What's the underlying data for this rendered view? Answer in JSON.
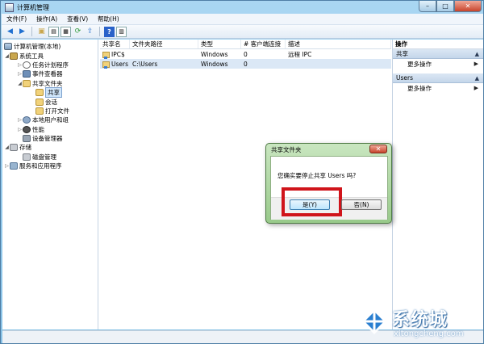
{
  "window": {
    "title": "计算机管理"
  },
  "menubar": [
    {
      "label": "文件(F)"
    },
    {
      "label": "操作(A)"
    },
    {
      "label": "查看(V)"
    },
    {
      "label": "帮助(H)"
    }
  ],
  "tree": {
    "root": "计算机管理(本地)",
    "system_tools": "系统工具",
    "task_scheduler": "任务计划程序",
    "event_viewer": "事件查看器",
    "shared_folders": "共享文件夹",
    "shares": "共享",
    "sessions": "会话",
    "open_files": "打开文件",
    "local_users": "本地用户和组",
    "performance": "性能",
    "device_manager": "设备管理器",
    "storage": "存储",
    "disk_mgmt": "磁盘管理",
    "services": "服务和应用程序"
  },
  "list": {
    "headers": [
      "共享名",
      "文件夹路径",
      "类型",
      "# 客户端连接",
      "描述"
    ],
    "rows": [
      {
        "name": "IPC$",
        "path": "",
        "type": "Windows",
        "clients": "0",
        "desc": "远程 IPC"
      },
      {
        "name": "Users",
        "path": "C:\\Users",
        "type": "Windows",
        "clients": "0",
        "desc": ""
      }
    ]
  },
  "actions": {
    "title": "操作",
    "section1": "共享",
    "section1_item": "更多操作",
    "section2": "Users",
    "section2_item": "更多操作"
  },
  "dialog": {
    "title": "共享文件夹",
    "message": "您确实要停止共享 Users 吗?",
    "yes": "是(Y)",
    "no": "否(N)"
  },
  "watermark": {
    "cn": "系统城",
    "en": "xitongcheng.com"
  },
  "colors": {
    "highlight": "#d0141a",
    "accent": "#2a62c9"
  }
}
